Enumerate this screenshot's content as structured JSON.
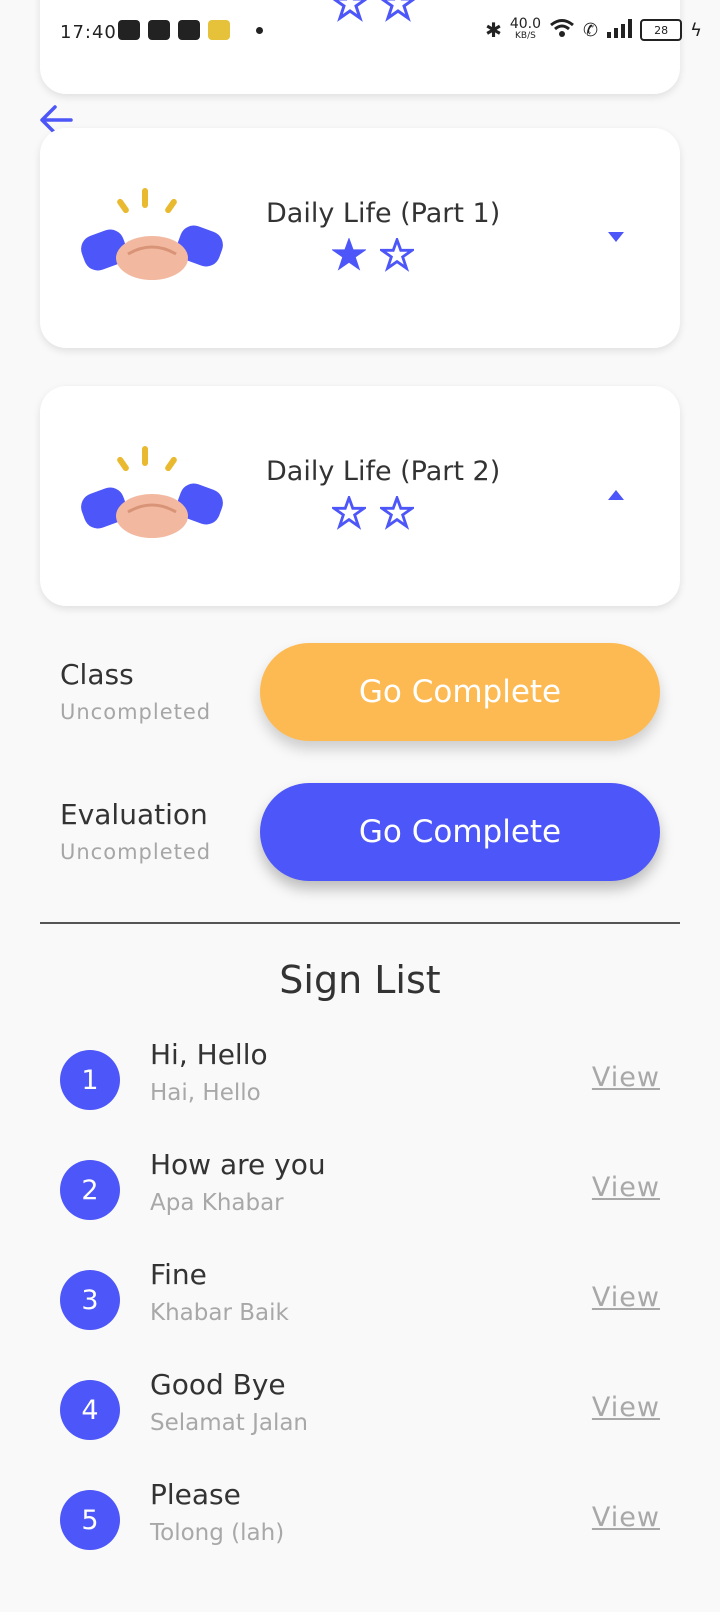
{
  "status_bar": {
    "time": "17:40",
    "net_speed": "40.0",
    "net_unit": "KB/S",
    "battery": "28"
  },
  "lessons": [
    {
      "title": "Daily Life (Part 1)",
      "stars_filled": 1,
      "stars_total": 2,
      "expanded": false
    },
    {
      "title": "Daily Life (Part 2)",
      "stars_filled": 0,
      "stars_total": 2,
      "expanded": true
    }
  ],
  "tasks": {
    "class": {
      "label": "Class",
      "status": "Uncompleted",
      "button": "Go Complete"
    },
    "evaluation": {
      "label": "Evaluation",
      "status": "Uncompleted",
      "button": "Go Complete"
    }
  },
  "sign_list": {
    "title": "Sign List",
    "view_label": "View",
    "items": [
      {
        "num": "1",
        "english": "Hi, Hello",
        "malay": "Hai, Hello"
      },
      {
        "num": "2",
        "english": "How are you",
        "malay": "Apa Khabar"
      },
      {
        "num": "3",
        "english": "Fine",
        "malay": "Khabar Baik"
      },
      {
        "num": "4",
        "english": "Good Bye",
        "malay": "Selamat Jalan"
      },
      {
        "num": "5",
        "english": "Please",
        "malay": "Tolong (lah)"
      }
    ]
  },
  "colors": {
    "accent": "#4d56f8",
    "orange": "#feba52"
  },
  "icons": {
    "back": "arrow-left-icon",
    "lesson": "handshake-icon",
    "star": "star-icon"
  }
}
